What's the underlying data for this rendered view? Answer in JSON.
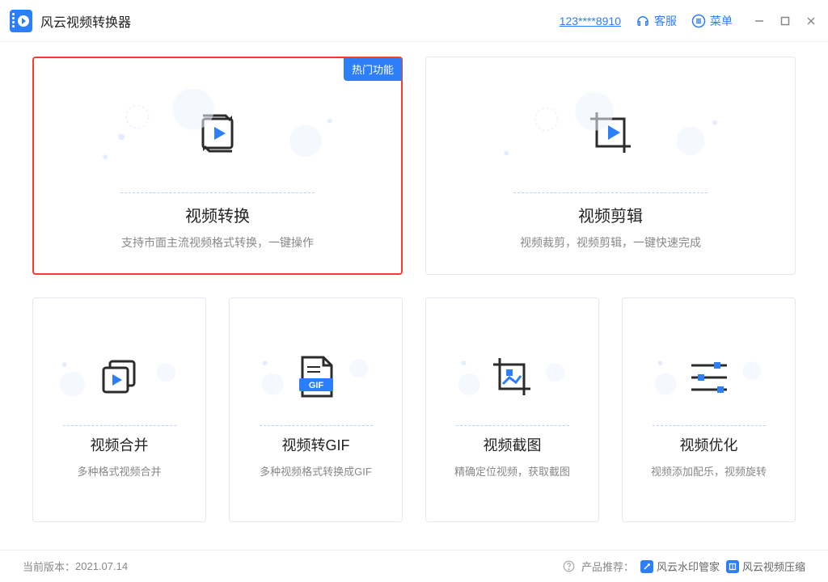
{
  "titlebar": {
    "app_name": "风云视频转换器",
    "account": "123****8910",
    "support": "客服",
    "menu": "菜单"
  },
  "cards": {
    "convert": {
      "badge": "热门功能",
      "title": "视频转换",
      "desc": "支持市面主流视频格式转换，一键操作"
    },
    "edit": {
      "title": "视频剪辑",
      "desc": "视频裁剪，视频剪辑，一键快速完成"
    },
    "merge": {
      "title": "视频合并",
      "desc": "多种格式视频合并"
    },
    "gif": {
      "title": "视频转GIF",
      "desc": "多种视频格式转换成GIF",
      "gif_label": "GIF"
    },
    "shot": {
      "title": "视频截图",
      "desc": "精确定位视频，获取截图"
    },
    "opt": {
      "title": "视频优化",
      "desc": "视频添加配乐，视频旋转"
    }
  },
  "footer": {
    "version_label": "当前版本：",
    "version_value": "2021.07.14",
    "recommend_label": "产品推荐：",
    "rec1": "风云水印管家",
    "rec2": "风云视频压缩"
  }
}
